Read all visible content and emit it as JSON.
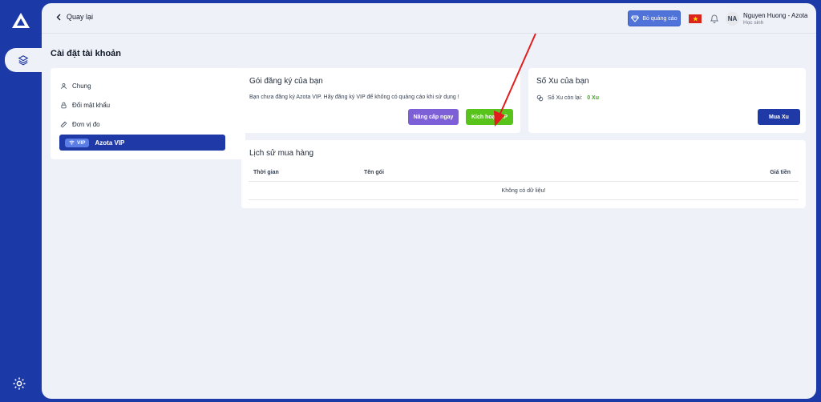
{
  "topbar": {
    "back_label": "Quay lại",
    "ad_button_label": "Bỏ quảng cáo",
    "avatar_initials": "NA",
    "user_name": "Nguyen Huong - Azota",
    "user_role": "Học sinh"
  },
  "page_title": "Cài đặt tài khoản",
  "settings_menu": {
    "items": [
      {
        "label": "Chung",
        "icon": "user-icon"
      },
      {
        "label": "Đổi mật khẩu",
        "icon": "lock-icon"
      },
      {
        "label": "Đơn vị đo",
        "icon": "ruler-icon"
      }
    ],
    "vip_badge": "VIP",
    "vip_label": "Azota VIP"
  },
  "subscription": {
    "title": "Gói đăng ký của bạn",
    "description": "Bạn chưa đăng ký Azota VIP. Hãy đăng ký VIP để không có quảng cáo khi sử dụng !",
    "upgrade_label": "Nâng cấp ngay",
    "activate_label": "Kích hoạt VIP"
  },
  "coins": {
    "title": "Số Xu của bạn",
    "remaining_label": "Số Xu còn lại:",
    "remaining_value": "0 Xu",
    "buy_label": "Mua Xu"
  },
  "history": {
    "title": "Lịch sử mua hàng",
    "columns": [
      "Thời gian",
      "Tên gói",
      "Giá tiền"
    ],
    "empty_text": "Không có dữ liệu!"
  },
  "colors": {
    "brand": "#1b3aa8",
    "upgrade": "#7d5fd8",
    "activate": "#58c41b",
    "annotation_arrow": "#e11d1d"
  }
}
